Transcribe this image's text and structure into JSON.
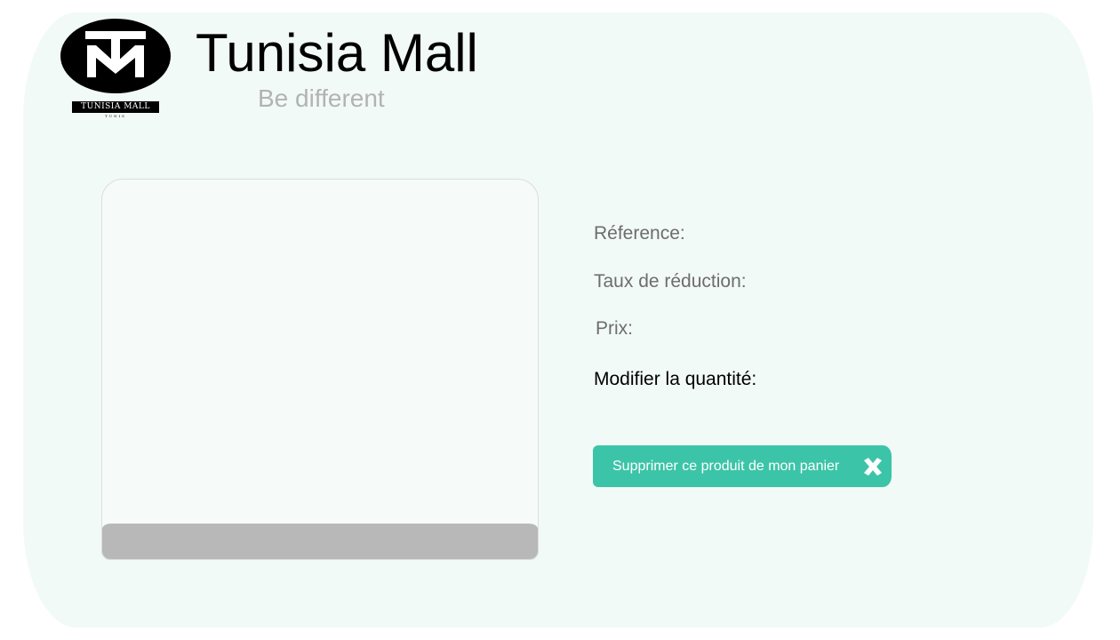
{
  "brand": {
    "name": "Tunisia Mall",
    "tagline": "Be different",
    "logo_bar_text": "TUNISIA MALL",
    "logo_sub_text": "TUNIS",
    "logo_icon": "tm-monogram-icon"
  },
  "product": {
    "image_placeholder": "product-image",
    "labels": {
      "reference": "Réference:",
      "discount_rate": "Taux de réduction:",
      "price": "Prix:",
      "modify_quantity": "Modifier la quantité:"
    }
  },
  "actions": {
    "remove_label": "Supprimer ce produit de mon panier",
    "remove_icon": "close-x-icon"
  },
  "colors": {
    "panel_bg": "#f2faf7",
    "accent": "#3cc4a8",
    "muted_text": "#6d6d6d",
    "tagline": "#b3b3b3"
  }
}
